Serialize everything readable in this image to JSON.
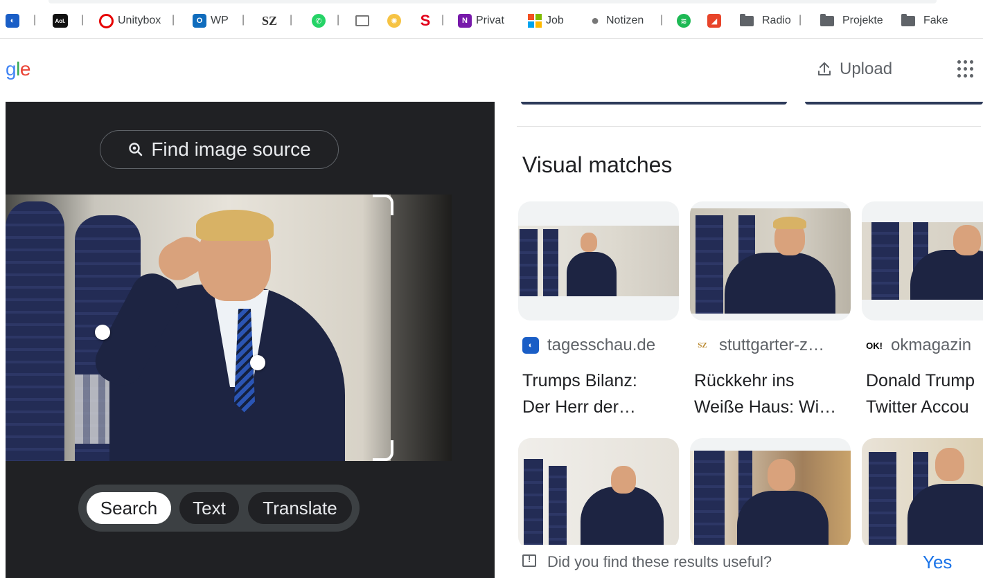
{
  "bookmarks": {
    "separator": "|",
    "items": [
      {
        "label": "",
        "icon": "tagesschau-icon",
        "color": "#1a5ec6"
      },
      {
        "label": "",
        "icon": "aol-icon",
        "color": "#111111",
        "glyph": "Aol."
      },
      {
        "label": "Unitybox",
        "icon": "vodafone-icon",
        "color": "#e60000"
      },
      {
        "label": "WP",
        "icon": "outlook-icon",
        "color": "#0f6cbd",
        "glyph": "O"
      },
      {
        "label": "",
        "icon": "sz-icon",
        "color": "#333333",
        "glyph": "SZ"
      },
      {
        "label": "",
        "icon": "whatsapp-icon",
        "color": "#25d366"
      },
      {
        "label": "",
        "icon": "reader-icon",
        "color": "#777777"
      },
      {
        "label": "",
        "icon": "lemon-icon",
        "color": "#f6c343"
      },
      {
        "label": "",
        "icon": "sparkasse-icon",
        "color": "#e2001a",
        "glyph": "S"
      },
      {
        "label": "Privat",
        "icon": "onenote-icon",
        "color": "#7719aa",
        "glyph": "N"
      },
      {
        "label": "Job",
        "icon": "microsoft-icon",
        "color": "#f25022"
      },
      {
        "label": "Notizen",
        "icon": "apple-icon",
        "color": "#777777"
      },
      {
        "label": "",
        "icon": "spotify-icon",
        "color": "#1db954"
      },
      {
        "label": "",
        "icon": "red-app-icon",
        "color": "#e8442a"
      },
      {
        "label": "Radio",
        "icon": "folder-icon",
        "color": "#5f6368"
      },
      {
        "label": "Projekte",
        "icon": "folder-icon",
        "color": "#5f6368"
      },
      {
        "label": "Fake",
        "icon": "folder-icon",
        "color": "#5f6368"
      }
    ]
  },
  "header": {
    "logo_parts": [
      "g",
      "l",
      "e"
    ],
    "upload_label": "Upload",
    "upload_icon": "upload-icon",
    "apps_icon": "apps-grid-icon"
  },
  "lens": {
    "find_source_label": "Find image source",
    "find_source_icon": "lens-search-icon",
    "modes": [
      {
        "label": "Search",
        "active": true
      },
      {
        "label": "Text",
        "active": false
      },
      {
        "label": "Translate",
        "active": false
      }
    ]
  },
  "results": {
    "title": "Visual matches",
    "cards": [
      {
        "source": "tagesschau.de",
        "source_icon": "tagesschau-icon",
        "line1": "Trumps Bilanz:",
        "line2": "Der Herr der…"
      },
      {
        "source": "stuttgarter-z…",
        "source_icon": "stuttgarter-icon",
        "line1": "Rückkehr ins",
        "line2": "Weiße Haus: Wi…"
      },
      {
        "source": "okmagazin",
        "source_icon": "ok-magazin-icon",
        "line1": "Donald Trump",
        "line2": "Twitter Accou"
      }
    ],
    "feedback_question": "Did you find these results useful?",
    "feedback_yes": "Yes"
  },
  "colors": {
    "dark_panel": "#202124",
    "accent_blue": "#1a73e8",
    "suit": "#1d2442"
  }
}
